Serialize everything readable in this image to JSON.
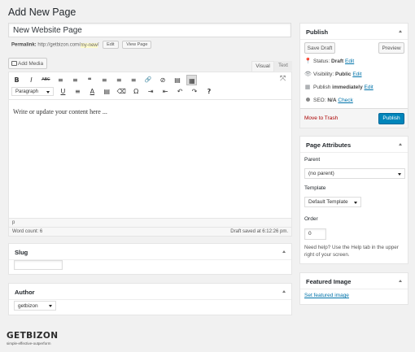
{
  "page_title": "Add New Page",
  "post_title": "New Website Page",
  "permalink": {
    "label": "Permalink:",
    "base": "http://getbizon.com/",
    "slug": "my-new",
    "trail": "/",
    "edit_label": "Edit",
    "view_label": "View Page"
  },
  "editor": {
    "add_media_label": "Add Media",
    "tab_visual": "Visual",
    "tab_text": "Text",
    "format_select": "Paragraph",
    "content": "Write or update your content here ...",
    "path": "p",
    "word_count": "Word count: 6",
    "draft_saved": "Draft saved at 6:12:26 pm.",
    "toolbar_row1": [
      "B",
      "I",
      "ABC",
      "≡",
      "≡",
      "❝",
      "≡",
      "≡",
      "≡",
      "🔗",
      "⊘",
      "▤",
      "▦"
    ],
    "toolbar_row2": [
      "U",
      "≡",
      "A",
      "▤",
      "⌫",
      "Ω",
      "⇥",
      "⇤",
      "↶",
      "↷",
      "?"
    ]
  },
  "slug_box": {
    "title": "Slug",
    "value": ""
  },
  "author_box": {
    "title": "Author",
    "selected": "getbizon"
  },
  "publish_box": {
    "title": "Publish",
    "save_draft": "Save Draft",
    "preview": "Preview",
    "status_label": "Status:",
    "status_value": "Draft",
    "visibility_label": "Visibility:",
    "visibility_value": "Public",
    "publish_label": "Publish",
    "publish_value": "immediately",
    "seo_label": "SEO:",
    "seo_value": "N/A",
    "seo_link": "Check",
    "edit_label": "Edit",
    "move_to_trash": "Move to Trash",
    "publish_button": "Publish"
  },
  "page_attributes": {
    "title": "Page Attributes",
    "parent_label": "Parent",
    "parent_value": "(no parent)",
    "template_label": "Template",
    "template_value": "Default Template",
    "order_label": "Order",
    "order_value": "0",
    "help_text": "Need help? Use the Help tab in the upper right of your screen."
  },
  "featured_image": {
    "title": "Featured Image",
    "link": "Set featured image"
  },
  "brand": {
    "logo_text": "GETBIZON",
    "tagline": "simple-effective-outperform"
  },
  "colors": {
    "accent": "#0073aa",
    "publish_button": "#0085ba",
    "trash": "#a00",
    "slug_highlight": "#fffbcc"
  }
}
